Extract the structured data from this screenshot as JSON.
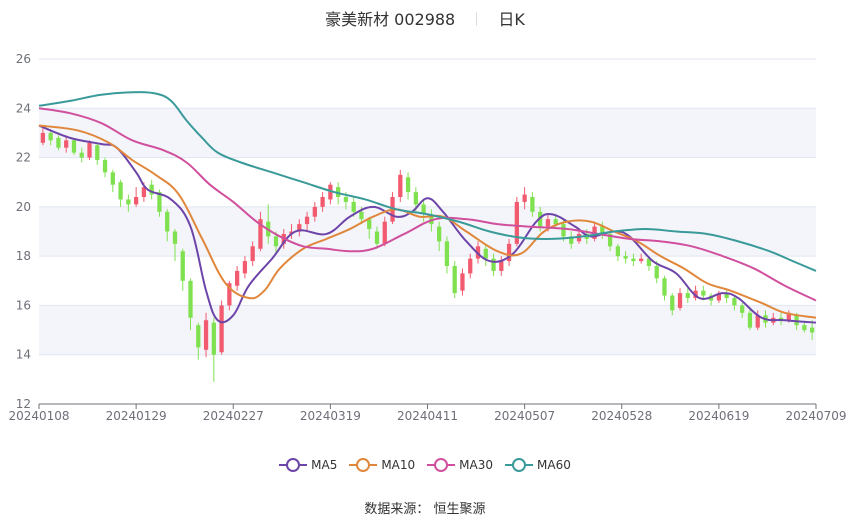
{
  "header": {
    "title": "豪美新材 002988",
    "period": "日K"
  },
  "source": "数据来源： 恒生聚源",
  "colors": {
    "up": "#f25b6f",
    "down": "#7fe14f",
    "grid": "#e0e6f1",
    "axis": "#6e7079",
    "band": "#f4f5fa"
  },
  "chart_data": {
    "type": "candlestick",
    "x_ticks": [
      "20240108",
      "20240129",
      "20240227",
      "20240319",
      "20240411",
      "20240507",
      "20240528",
      "20240619",
      "20240709"
    ],
    "ylim": [
      12,
      26
    ],
    "y_ticks": [
      "12",
      "14",
      "16",
      "18",
      "20",
      "22",
      "24",
      "26"
    ],
    "grid": true,
    "legend_position": "bottom",
    "ohlc_fields": [
      "open",
      "close",
      "low",
      "high"
    ],
    "candles": [
      [
        22.6,
        23.0,
        22.5,
        23.3
      ],
      [
        23.0,
        22.7,
        22.5,
        23.1
      ],
      [
        22.8,
        22.4,
        22.3,
        22.9
      ],
      [
        22.4,
        22.7,
        22.2,
        22.9
      ],
      [
        22.7,
        22.2,
        22.1,
        22.8
      ],
      [
        22.2,
        22.0,
        21.8,
        22.4
      ],
      [
        22.0,
        22.6,
        21.9,
        22.7
      ],
      [
        22.5,
        21.9,
        21.7,
        22.6
      ],
      [
        21.9,
        21.4,
        21.2,
        22.0
      ],
      [
        21.4,
        20.9,
        20.6,
        21.5
      ],
      [
        21.0,
        20.3,
        20.0,
        21.1
      ],
      [
        20.3,
        20.1,
        19.8,
        20.5
      ],
      [
        20.1,
        20.4,
        20.0,
        20.8
      ],
      [
        20.4,
        20.8,
        20.2,
        21.0
      ],
      [
        20.9,
        20.5,
        20.3,
        21.1
      ],
      [
        20.6,
        19.8,
        19.6,
        20.7
      ],
      [
        19.8,
        19.0,
        18.6,
        19.9
      ],
      [
        19.0,
        18.5,
        17.8,
        19.1
      ],
      [
        18.2,
        17.0,
        16.6,
        18.3
      ],
      [
        17.0,
        15.5,
        15.0,
        17.1
      ],
      [
        15.2,
        14.3,
        13.8,
        15.3
      ],
      [
        14.2,
        15.4,
        13.9,
        15.7
      ],
      [
        15.3,
        14.0,
        12.9,
        15.5
      ],
      [
        14.1,
        16.0,
        14.0,
        16.2
      ],
      [
        16.0,
        16.9,
        15.8,
        17.0
      ],
      [
        16.8,
        17.4,
        16.6,
        17.6
      ],
      [
        17.3,
        17.8,
        17.1,
        18.0
      ],
      [
        17.8,
        18.4,
        17.6,
        18.6
      ],
      [
        18.3,
        19.5,
        18.2,
        19.8
      ],
      [
        19.4,
        18.8,
        18.5,
        20.1
      ],
      [
        18.8,
        18.4,
        18.1,
        19.0
      ],
      [
        18.5,
        18.9,
        18.3,
        19.1
      ],
      [
        18.9,
        19.0,
        18.7,
        19.3
      ],
      [
        19.0,
        19.3,
        18.8,
        19.5
      ],
      [
        19.3,
        19.6,
        19.0,
        19.8
      ],
      [
        19.6,
        20.0,
        19.4,
        20.2
      ],
      [
        20.0,
        20.4,
        19.8,
        20.6
      ],
      [
        20.3,
        20.9,
        20.1,
        21.0
      ],
      [
        20.8,
        20.4,
        20.1,
        21.0
      ],
      [
        20.4,
        20.2,
        19.9,
        20.6
      ],
      [
        20.2,
        19.8,
        19.6,
        20.4
      ],
      [
        19.8,
        19.5,
        19.3,
        20.0
      ],
      [
        19.5,
        19.1,
        18.7,
        19.6
      ],
      [
        19.0,
        18.5,
        18.3,
        19.2
      ],
      [
        18.5,
        19.4,
        18.4,
        19.6
      ],
      [
        19.4,
        20.4,
        19.3,
        20.6
      ],
      [
        20.4,
        21.3,
        20.2,
        21.5
      ],
      [
        21.2,
        20.6,
        20.3,
        21.4
      ],
      [
        20.6,
        20.1,
        19.8,
        20.8
      ],
      [
        20.1,
        19.7,
        19.4,
        20.3
      ],
      [
        19.7,
        19.3,
        19.0,
        19.9
      ],
      [
        19.2,
        18.6,
        18.2,
        19.4
      ],
      [
        18.6,
        17.6,
        17.3,
        18.8
      ],
      [
        17.6,
        16.5,
        16.3,
        17.8
      ],
      [
        16.6,
        17.3,
        16.4,
        17.5
      ],
      [
        17.3,
        17.9,
        17.1,
        18.1
      ],
      [
        17.9,
        18.4,
        17.7,
        18.6
      ],
      [
        18.3,
        17.9,
        17.6,
        18.5
      ],
      [
        17.9,
        17.4,
        17.2,
        18.1
      ],
      [
        17.4,
        17.8,
        17.2,
        18.0
      ],
      [
        17.8,
        18.5,
        17.6,
        18.7
      ],
      [
        18.5,
        20.2,
        18.4,
        20.4
      ],
      [
        20.2,
        20.5,
        19.9,
        20.8
      ],
      [
        20.4,
        19.8,
        19.6,
        20.6
      ],
      [
        19.8,
        19.2,
        19.0,
        20.0
      ],
      [
        19.2,
        19.5,
        19.0,
        19.7
      ],
      [
        19.5,
        19.3,
        19.1,
        19.7
      ],
      [
        19.3,
        18.8,
        18.6,
        19.5
      ],
      [
        18.8,
        18.5,
        18.3,
        19.0
      ],
      [
        18.6,
        18.9,
        18.5,
        19.1
      ],
      [
        18.9,
        18.7,
        18.5,
        19.1
      ],
      [
        18.7,
        19.2,
        18.6,
        19.4
      ],
      [
        19.2,
        18.9,
        18.7,
        19.4
      ],
      [
        18.9,
        18.4,
        18.2,
        19.0
      ],
      [
        18.4,
        18.0,
        17.8,
        18.5
      ],
      [
        18.0,
        17.9,
        17.7,
        18.2
      ],
      [
        17.9,
        17.8,
        17.6,
        18.1
      ],
      [
        17.8,
        17.9,
        17.7,
        18.1
      ],
      [
        17.9,
        17.6,
        17.4,
        18.0
      ],
      [
        17.6,
        17.1,
        16.9,
        17.8
      ],
      [
        17.1,
        16.4,
        16.2,
        17.2
      ],
      [
        16.4,
        15.8,
        15.6,
        16.5
      ],
      [
        15.9,
        16.5,
        15.8,
        16.7
      ],
      [
        16.5,
        16.3,
        16.1,
        16.7
      ],
      [
        16.3,
        16.6,
        16.2,
        16.8
      ],
      [
        16.6,
        16.4,
        16.2,
        16.8
      ],
      [
        16.4,
        16.2,
        16.0,
        16.5
      ],
      [
        16.2,
        16.5,
        16.1,
        16.6
      ],
      [
        16.5,
        16.3,
        16.1,
        16.6
      ],
      [
        16.3,
        16.0,
        15.8,
        16.4
      ],
      [
        16.0,
        15.7,
        15.5,
        16.1
      ],
      [
        15.7,
        15.1,
        15.0,
        15.9
      ],
      [
        15.1,
        15.6,
        15.0,
        15.8
      ],
      [
        15.6,
        15.3,
        15.1,
        15.8
      ],
      [
        15.3,
        15.5,
        15.2,
        15.7
      ],
      [
        15.5,
        15.4,
        15.2,
        15.7
      ],
      [
        15.4,
        15.7,
        15.3,
        15.8
      ],
      [
        15.6,
        15.2,
        15.0,
        15.7
      ],
      [
        15.2,
        15.0,
        14.9,
        15.3
      ],
      [
        15.1,
        14.9,
        14.6,
        15.4
      ]
    ],
    "series": [
      {
        "name": "MA5",
        "color": "#6d44a8",
        "values": [
          {
            "x": 0,
            "y": 23.3
          },
          {
            "x": 0.04,
            "y": 22.8
          },
          {
            "x": 0.08,
            "y": 22.55
          },
          {
            "x": 0.1,
            "y": 22.4
          },
          {
            "x": 0.125,
            "y": 21.4
          },
          {
            "x": 0.14,
            "y": 20.7
          },
          {
            "x": 0.17,
            "y": 20.3
          },
          {
            "x": 0.195,
            "y": 19.2
          },
          {
            "x": 0.215,
            "y": 16.6
          },
          {
            "x": 0.23,
            "y": 15.4
          },
          {
            "x": 0.25,
            "y": 15.6
          },
          {
            "x": 0.27,
            "y": 16.8
          },
          {
            "x": 0.3,
            "y": 17.9
          },
          {
            "x": 0.33,
            "y": 19.0
          },
          {
            "x": 0.37,
            "y": 18.9
          },
          {
            "x": 0.4,
            "y": 19.6
          },
          {
            "x": 0.43,
            "y": 20.0
          },
          {
            "x": 0.46,
            "y": 19.6
          },
          {
            "x": 0.48,
            "y": 19.8
          },
          {
            "x": 0.5,
            "y": 20.35
          },
          {
            "x": 0.52,
            "y": 19.8
          },
          {
            "x": 0.55,
            "y": 18.6
          },
          {
            "x": 0.58,
            "y": 17.8
          },
          {
            "x": 0.61,
            "y": 18.1
          },
          {
            "x": 0.64,
            "y": 19.4
          },
          {
            "x": 0.66,
            "y": 19.7
          },
          {
            "x": 0.69,
            "y": 19.2
          },
          {
            "x": 0.71,
            "y": 18.8
          },
          {
            "x": 0.74,
            "y": 19.0
          },
          {
            "x": 0.76,
            "y": 18.8
          },
          {
            "x": 0.79,
            "y": 17.8
          },
          {
            "x": 0.82,
            "y": 17.3
          },
          {
            "x": 0.85,
            "y": 16.3
          },
          {
            "x": 0.88,
            "y": 16.5
          },
          {
            "x": 0.9,
            "y": 16.3
          },
          {
            "x": 0.93,
            "y": 15.5
          },
          {
            "x": 0.96,
            "y": 15.4
          },
          {
            "x": 1.0,
            "y": 15.3
          }
        ]
      },
      {
        "name": "MA10",
        "color": "#e0873c",
        "values": [
          {
            "x": 0,
            "y": 23.3
          },
          {
            "x": 0.05,
            "y": 23.1
          },
          {
            "x": 0.09,
            "y": 22.6
          },
          {
            "x": 0.12,
            "y": 21.9
          },
          {
            "x": 0.15,
            "y": 21.3
          },
          {
            "x": 0.18,
            "y": 20.5
          },
          {
            "x": 0.21,
            "y": 18.7
          },
          {
            "x": 0.24,
            "y": 16.9
          },
          {
            "x": 0.27,
            "y": 16.3
          },
          {
            "x": 0.29,
            "y": 16.6
          },
          {
            "x": 0.31,
            "y": 17.5
          },
          {
            "x": 0.34,
            "y": 18.3
          },
          {
            "x": 0.37,
            "y": 18.7
          },
          {
            "x": 0.4,
            "y": 19.1
          },
          {
            "x": 0.43,
            "y": 19.6
          },
          {
            "x": 0.46,
            "y": 19.9
          },
          {
            "x": 0.49,
            "y": 19.6
          },
          {
            "x": 0.52,
            "y": 19.6
          },
          {
            "x": 0.55,
            "y": 19.0
          },
          {
            "x": 0.59,
            "y": 18.2
          },
          {
            "x": 0.62,
            "y": 18.1
          },
          {
            "x": 0.65,
            "y": 19.0
          },
          {
            "x": 0.68,
            "y": 19.4
          },
          {
            "x": 0.71,
            "y": 19.4
          },
          {
            "x": 0.74,
            "y": 19.0
          },
          {
            "x": 0.77,
            "y": 18.6
          },
          {
            "x": 0.8,
            "y": 18.0
          },
          {
            "x": 0.83,
            "y": 17.5
          },
          {
            "x": 0.86,
            "y": 16.9
          },
          {
            "x": 0.89,
            "y": 16.6
          },
          {
            "x": 0.93,
            "y": 16.1
          },
          {
            "x": 0.96,
            "y": 15.7
          },
          {
            "x": 1.0,
            "y": 15.5
          }
        ]
      },
      {
        "name": "MA30",
        "color": "#d0509e",
        "values": [
          {
            "x": 0,
            "y": 24.0
          },
          {
            "x": 0.04,
            "y": 23.8
          },
          {
            "x": 0.08,
            "y": 23.4
          },
          {
            "x": 0.12,
            "y": 22.7
          },
          {
            "x": 0.16,
            "y": 22.3
          },
          {
            "x": 0.19,
            "y": 21.8
          },
          {
            "x": 0.22,
            "y": 20.9
          },
          {
            "x": 0.25,
            "y": 20.2
          },
          {
            "x": 0.28,
            "y": 19.4
          },
          {
            "x": 0.31,
            "y": 18.8
          },
          {
            "x": 0.34,
            "y": 18.4
          },
          {
            "x": 0.37,
            "y": 18.3
          },
          {
            "x": 0.4,
            "y": 18.2
          },
          {
            "x": 0.43,
            "y": 18.3
          },
          {
            "x": 0.47,
            "y": 18.9
          },
          {
            "x": 0.51,
            "y": 19.5
          },
          {
            "x": 0.55,
            "y": 19.5
          },
          {
            "x": 0.59,
            "y": 19.3
          },
          {
            "x": 0.63,
            "y": 19.2
          },
          {
            "x": 0.68,
            "y": 19.1
          },
          {
            "x": 0.72,
            "y": 18.9
          },
          {
            "x": 0.76,
            "y": 18.7
          },
          {
            "x": 0.8,
            "y": 18.6
          },
          {
            "x": 0.84,
            "y": 18.4
          },
          {
            "x": 0.88,
            "y": 18.0
          },
          {
            "x": 0.92,
            "y": 17.5
          },
          {
            "x": 0.96,
            "y": 16.8
          },
          {
            "x": 1.0,
            "y": 16.2
          }
        ]
      },
      {
        "name": "MA60",
        "color": "#3a9a9a",
        "values": [
          {
            "x": 0,
            "y": 24.1
          },
          {
            "x": 0.04,
            "y": 24.3
          },
          {
            "x": 0.08,
            "y": 24.55
          },
          {
            "x": 0.12,
            "y": 24.65
          },
          {
            "x": 0.15,
            "y": 24.6
          },
          {
            "x": 0.17,
            "y": 24.3
          },
          {
            "x": 0.19,
            "y": 23.5
          },
          {
            "x": 0.21,
            "y": 22.8
          },
          {
            "x": 0.23,
            "y": 22.2
          },
          {
            "x": 0.26,
            "y": 21.8
          },
          {
            "x": 0.3,
            "y": 21.4
          },
          {
            "x": 0.34,
            "y": 21.0
          },
          {
            "x": 0.38,
            "y": 20.6
          },
          {
            "x": 0.42,
            "y": 20.3
          },
          {
            "x": 0.46,
            "y": 19.9
          },
          {
            "x": 0.5,
            "y": 19.7
          },
          {
            "x": 0.54,
            "y": 19.4
          },
          {
            "x": 0.58,
            "y": 19.0
          },
          {
            "x": 0.62,
            "y": 18.75
          },
          {
            "x": 0.66,
            "y": 18.7
          },
          {
            "x": 0.7,
            "y": 18.8
          },
          {
            "x": 0.74,
            "y": 19.0
          },
          {
            "x": 0.78,
            "y": 19.1
          },
          {
            "x": 0.82,
            "y": 19.0
          },
          {
            "x": 0.86,
            "y": 18.9
          },
          {
            "x": 0.9,
            "y": 18.6
          },
          {
            "x": 0.94,
            "y": 18.2
          },
          {
            "x": 0.97,
            "y": 17.8
          },
          {
            "x": 1.0,
            "y": 17.4
          }
        ]
      }
    ]
  }
}
